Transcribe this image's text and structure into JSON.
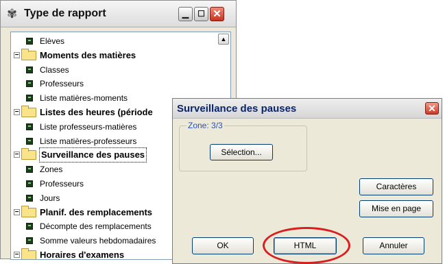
{
  "report_window": {
    "title": "Type de rapport",
    "tree": [
      {
        "type": "item",
        "label": "Elèves"
      },
      {
        "type": "group",
        "label": "Moments des matières"
      },
      {
        "type": "item",
        "label": "Classes"
      },
      {
        "type": "item",
        "label": "Professeurs"
      },
      {
        "type": "item",
        "label": "Liste matières-moments"
      },
      {
        "type": "group",
        "label": "Listes des heures (période"
      },
      {
        "type": "item",
        "label": "Liste professeurs-matières"
      },
      {
        "type": "item",
        "label": "Liste matières-professeurs"
      },
      {
        "type": "group",
        "label": "Surveillance des pauses",
        "selected": true
      },
      {
        "type": "item",
        "label": "Zones"
      },
      {
        "type": "item",
        "label": "Professeurs"
      },
      {
        "type": "item",
        "label": "Jours"
      },
      {
        "type": "group",
        "label": "Planif. des remplacements"
      },
      {
        "type": "item",
        "label": "Décompte des remplacements"
      },
      {
        "type": "item",
        "label": "Somme valeurs hebdomadaires"
      },
      {
        "type": "group",
        "label": "Horaires d'examens"
      }
    ]
  },
  "dialog": {
    "title": "Surveillance des pauses",
    "zone_legend": "Zone: 3/3",
    "selection_button": "Sélection...",
    "characters_button": "Caractères",
    "page_setup_button": "Mise en page",
    "ok_button": "OK",
    "html_button": "HTML",
    "cancel_button": "Annuler"
  },
  "colors": {
    "highlight_circle": "#d81e1e",
    "zone_legend": "#2152c4"
  }
}
